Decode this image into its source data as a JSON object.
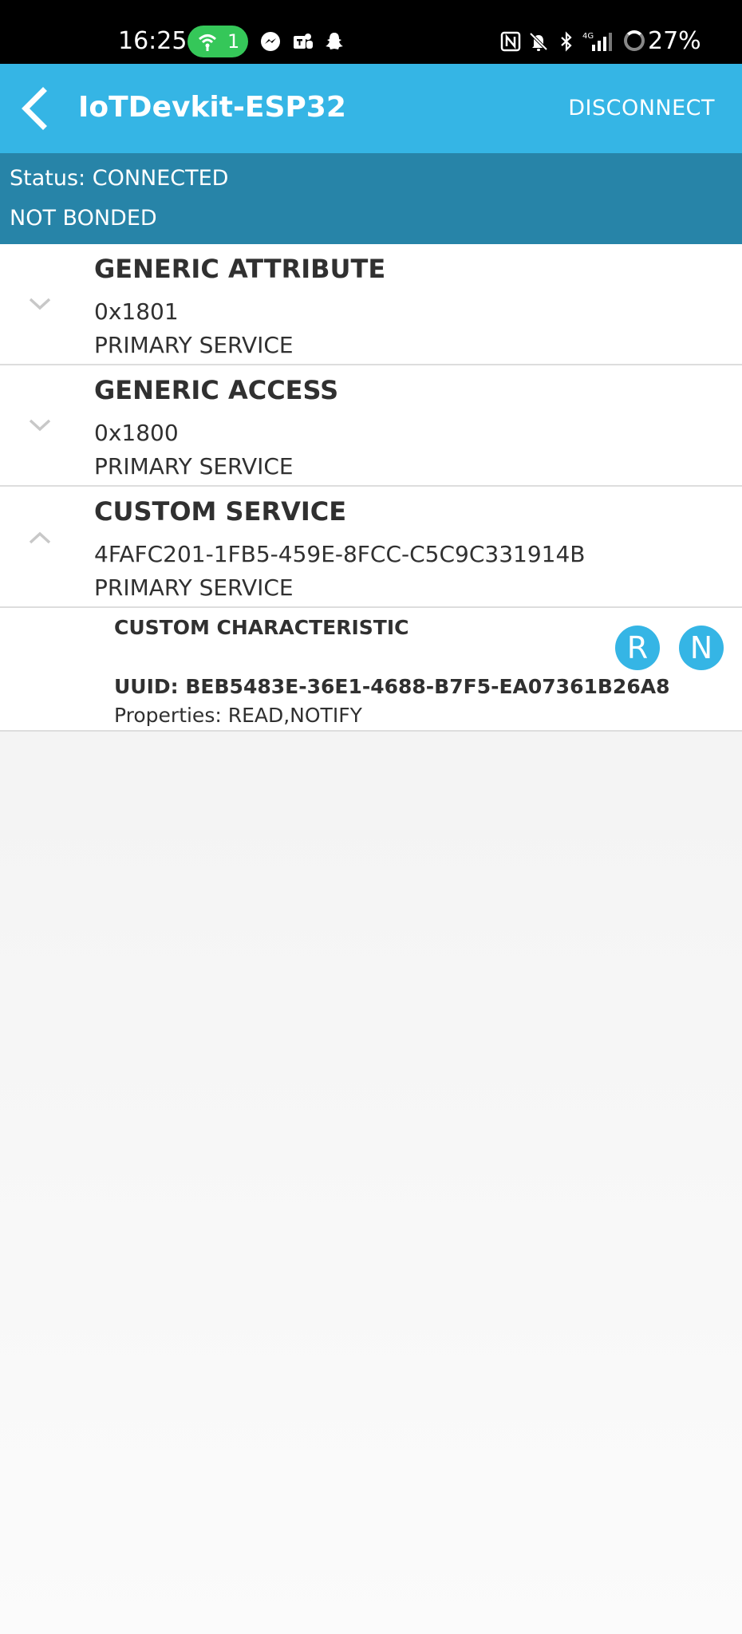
{
  "statusbar": {
    "time": "16:25",
    "hotspot_count": "1",
    "battery": "27%",
    "icons": [
      "messenger-icon",
      "teams-icon",
      "snapchat-icon",
      "nfc-icon",
      "mute-icon",
      "bluetooth-icon",
      "signal-4g-icon"
    ]
  },
  "appbar": {
    "title": "IoTDevkit-ESP32",
    "disconnect_label": "DISCONNECT",
    "color": "#35b5e5"
  },
  "connection": {
    "status": "Status: CONNECTED",
    "bond": "NOT BONDED",
    "color": "#2784a8"
  },
  "services": [
    {
      "name": "GENERIC ATTRIBUTE",
      "uuid": "0x1801",
      "type": "PRIMARY SERVICE",
      "expanded": false
    },
    {
      "name": "GENERIC ACCESS",
      "uuid": "0x1800",
      "type": "PRIMARY SERVICE",
      "expanded": false
    },
    {
      "name": "CUSTOM SERVICE",
      "uuid": "4FAFC201-1FB5-459E-8FCC-C5C9C331914B",
      "type": "PRIMARY SERVICE",
      "expanded": true
    }
  ],
  "characteristic": {
    "name": "CUSTOM CHARACTERISTIC",
    "uuid": "UUID: BEB5483E-36E1-4688-B7F5-EA07361B26A8",
    "properties": "Properties: READ,NOTIFY",
    "read_label": "R",
    "notify_label": "N"
  }
}
